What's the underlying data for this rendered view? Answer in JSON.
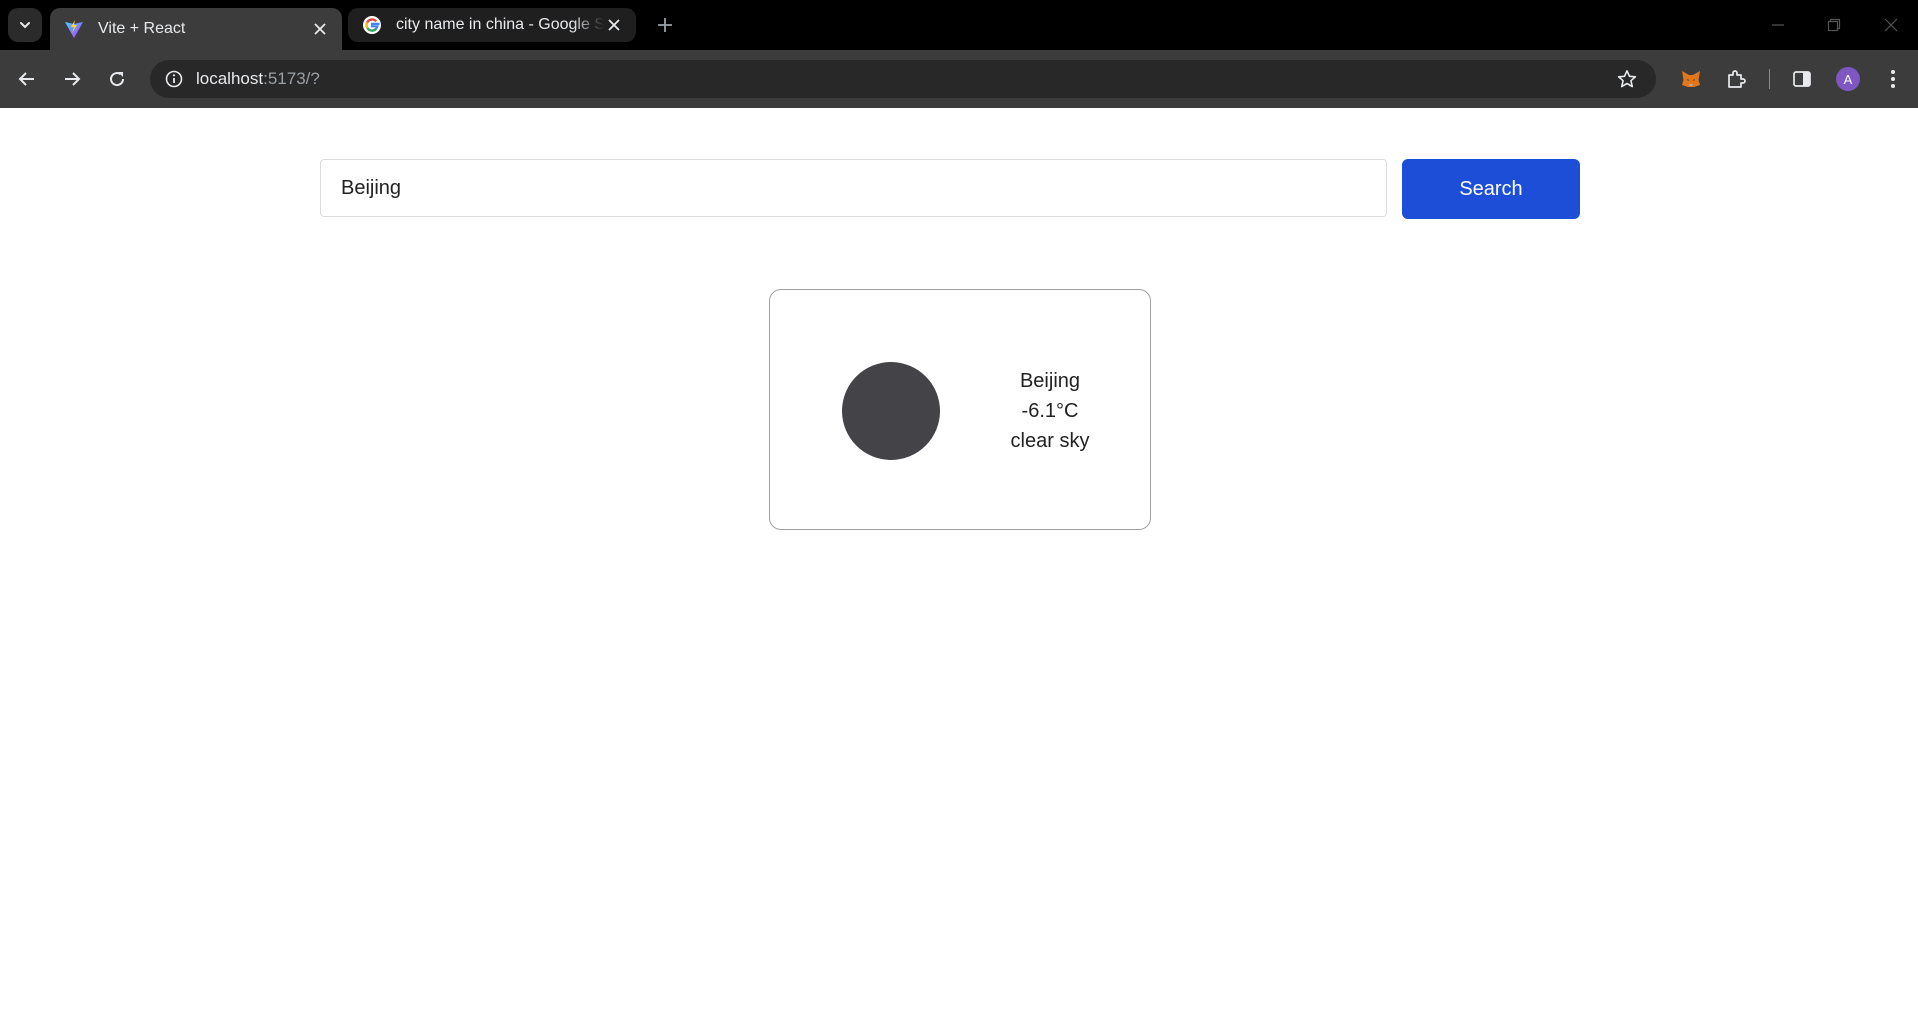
{
  "browser": {
    "tabs": [
      {
        "title": "Vite + React",
        "active": true,
        "icon": "vite-icon"
      },
      {
        "title": "city name in china - Google Search",
        "active": false,
        "icon": "google-icon"
      }
    ],
    "address_host": "localhost",
    "address_path": ":5173/?",
    "profile_initial": "A",
    "colors": {
      "tabbar": "#000000",
      "toolbar": "#3c3c3c",
      "omnibox": "#282828",
      "avatar": "#7e57c2"
    }
  },
  "search": {
    "value": "Beijing",
    "button_label": "Search",
    "button_color": "#1d4ed8"
  },
  "weather": {
    "city": "Beijing",
    "temperature": "-6.1°C",
    "description": "clear sky",
    "icon_color": "#444448"
  }
}
